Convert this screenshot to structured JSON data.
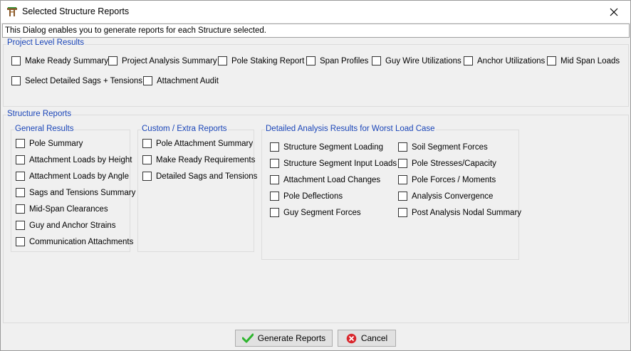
{
  "window": {
    "title": "Selected Structure Reports",
    "info": "This Dialog enables you to generate reports for each Structure selected."
  },
  "project": {
    "title": "Project Level Results",
    "items": [
      {
        "label": "Make Ready Summary",
        "checked": false
      },
      {
        "label": "Project Analysis Summary",
        "checked": false
      },
      {
        "label": "Pole Staking Report",
        "checked": false
      },
      {
        "label": "Span Profiles",
        "checked": false
      },
      {
        "label": "Guy Wire Utilizations",
        "checked": false
      },
      {
        "label": "Anchor Utilizations",
        "checked": false
      },
      {
        "label": "Mid Span Loads",
        "checked": false
      },
      {
        "label": "Select Detailed Sags + Tensions",
        "checked": false
      },
      {
        "label": "Attachment Audit",
        "checked": false
      }
    ]
  },
  "structure": {
    "title": "Structure Reports",
    "general": {
      "title": "General Results",
      "items": [
        {
          "label": "Pole Summary",
          "checked": false
        },
        {
          "label": "Attachment Loads by Height",
          "checked": false
        },
        {
          "label": "Attachment Loads by Angle",
          "checked": false
        },
        {
          "label": "Sags and Tensions Summary",
          "checked": false
        },
        {
          "label": "Mid-Span Clearances",
          "checked": false
        },
        {
          "label": "Guy and Anchor Strains",
          "checked": false
        },
        {
          "label": "Communication Attachments",
          "checked": false
        }
      ]
    },
    "custom": {
      "title": "Custom / Extra Reports",
      "items": [
        {
          "label": "Pole Attachment Summary",
          "checked": false
        },
        {
          "label": "Make Ready Requirements",
          "checked": false
        },
        {
          "label": "Detailed Sags and Tensions",
          "checked": false
        }
      ]
    },
    "detailed": {
      "title": "Detailed Analysis Results for Worst Load Case",
      "items": [
        {
          "label": "Structure Segment Loading",
          "checked": false
        },
        {
          "label": "Structure Segment Input Loads",
          "checked": false
        },
        {
          "label": "Attachment Load Changes",
          "checked": false
        },
        {
          "label": "Pole Deflections",
          "checked": false
        },
        {
          "label": "Guy Segment Forces",
          "checked": false
        },
        {
          "label": "Soil Segment Forces",
          "checked": false
        },
        {
          "label": "Pole Stresses/Capacity",
          "checked": false
        },
        {
          "label": "Pole Forces / Moments",
          "checked": false
        },
        {
          "label": "Analysis Convergence",
          "checked": false
        },
        {
          "label": "Post Analysis Nodal Summary",
          "checked": false
        }
      ]
    }
  },
  "buttons": {
    "generate": "Generate Reports",
    "cancel": "Cancel"
  },
  "icons": {
    "app": "pole-icon",
    "close": "close-icon",
    "generate": "checkmark-icon",
    "cancel": "cancel-icon"
  },
  "colors": {
    "group_title": "#1a45b8",
    "check_green": "#2db52d",
    "cancel_red": "#d9262c"
  }
}
